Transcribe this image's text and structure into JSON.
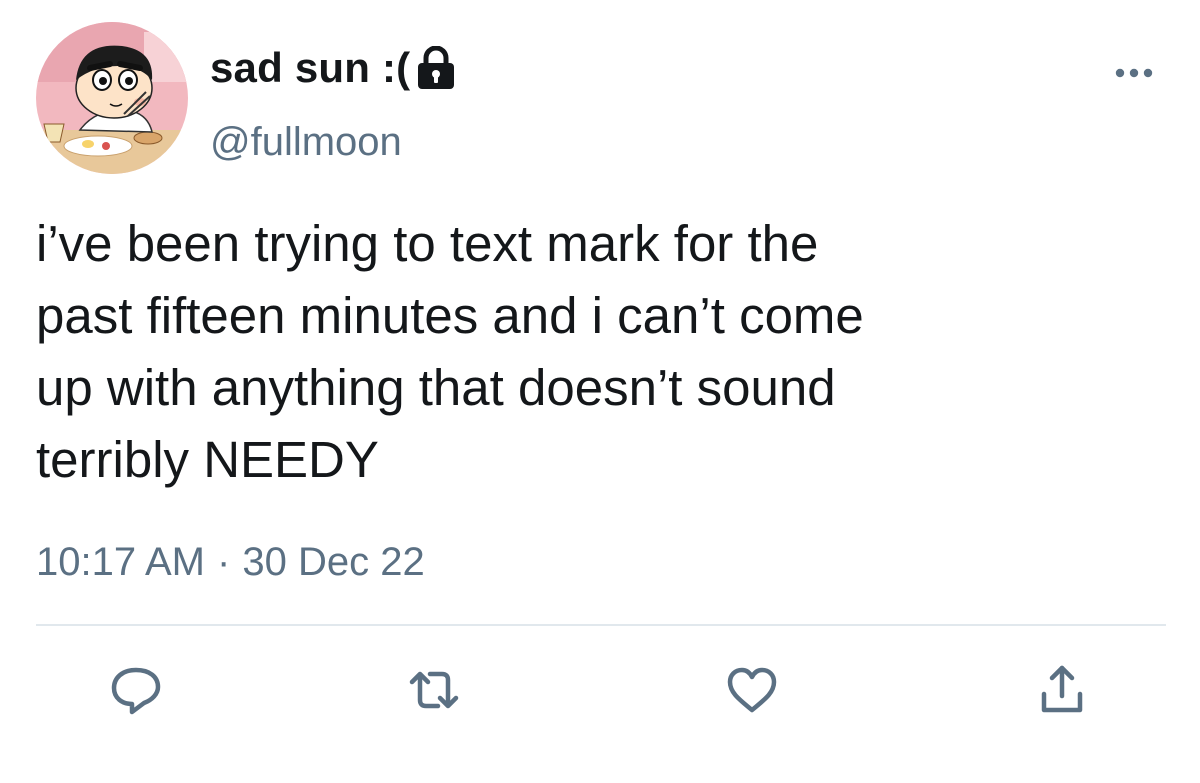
{
  "user": {
    "display_name": "sad sun :(",
    "handle": "@fullmoon",
    "protected_icon": "lock-icon",
    "avatar_icon": "cartoon-boy-eating-avatar"
  },
  "tweet": {
    "text": "i’ve been trying to text mark for the\npast fifteen minutes and i can’t come\nup with anything that doesn’t sound\nterribly NEEDY",
    "time": "10:17 AM",
    "separator": "·",
    "date": "30 Dec 22"
  },
  "actions": {
    "more": "more-options-icon",
    "reply": "reply-icon",
    "retweet": "retweet-icon",
    "like": "like-heart-icon",
    "share": "share-icon"
  },
  "colors": {
    "text": "#14171a",
    "secondary": "#5b7083",
    "divider": "#e1e8ed",
    "background": "#ffffff"
  }
}
